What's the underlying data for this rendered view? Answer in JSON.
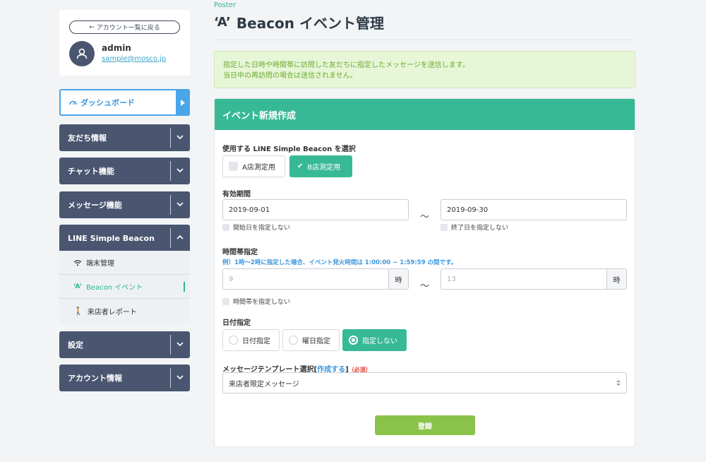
{
  "sidebar": {
    "back_label": "アカウント一覧に戻る",
    "user": {
      "name": "admin",
      "email": "sample@mosco.jp"
    },
    "menu": {
      "dashboard": "ダッシュボード",
      "friends": "友だち情報",
      "chat": "チャット機能",
      "message": "メッセージ機能",
      "beacon": "LINE Simple Beacon",
      "settings": "設定",
      "account": "アカウント情報"
    },
    "beacon_sub": [
      "端末管理",
      "Beacon イベント",
      "来店者レポート"
    ]
  },
  "header": {
    "breadcrumb": "Poster",
    "title": "Beacon イベント管理"
  },
  "notice": {
    "line1": "指定した日時や時間帯に訪問した友だちに指定したメッセージを送信します。",
    "line2": "当日中の再訪問の場合は送信されません。"
  },
  "form": {
    "card_title": "イベント新規作成",
    "beacon_label": "使用する LINE Simple Beacon を選択",
    "beacons": [
      {
        "label": "A店測定用",
        "selected": false
      },
      {
        "label": "B店測定用",
        "selected": true
      }
    ],
    "period_label": "有効期間",
    "start_date": "2019-09-01",
    "end_date": "2019-09-30",
    "tilde": "〜",
    "no_start": "開始日を指定しない",
    "no_end": "終了日を指定しない",
    "time_label": "時間帯指定",
    "time_hint": "例）1時〜2時に指定した場合、イベント発火時間は 1:00:00 ~ 1:59:59 の間です。",
    "time_start_placeholder": "9",
    "time_end_placeholder": "13",
    "hour_unit": "時",
    "no_time": "時間帯を指定しない",
    "day_label": "日付指定",
    "day_options": [
      {
        "label": "日付指定",
        "selected": false
      },
      {
        "label": "曜日指定",
        "selected": false
      },
      {
        "label": "指定しない",
        "selected": true
      }
    ],
    "template_label": "メッセージテンプレート選択[",
    "template_link": "作成する",
    "template_label_end": "]",
    "required": "（必須）",
    "template_value": "来店者限定メッセージ",
    "submit": "登録"
  },
  "colors": {
    "accent": "#38b996",
    "nav": "#4a5670",
    "submit": "#8bc34a",
    "dashboard_border": "#4aa6e9"
  }
}
